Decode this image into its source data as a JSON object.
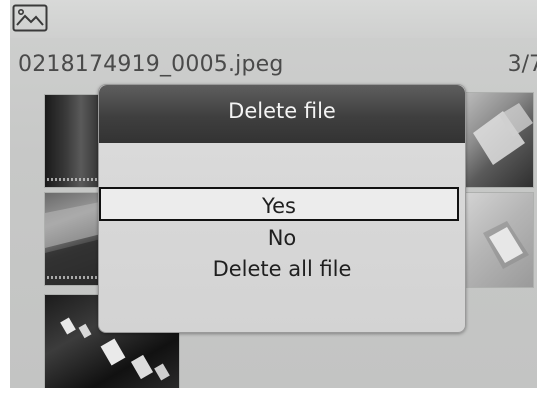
{
  "header": {
    "icon": "gallery-icon"
  },
  "file": {
    "name": "0218174919_0005.jpeg",
    "counter": "3/7"
  },
  "dialog": {
    "title": "Delete file",
    "options": [
      {
        "label": "Yes",
        "selected": true
      },
      {
        "label": "No",
        "selected": false
      },
      {
        "label": "Delete all file",
        "selected": false
      }
    ]
  },
  "colors": {
    "dialog_header": "#3f3f3f",
    "dialog_body": "#d8d8d8",
    "selection_border": "#111111",
    "screen_bg": "#c8c9c8"
  }
}
